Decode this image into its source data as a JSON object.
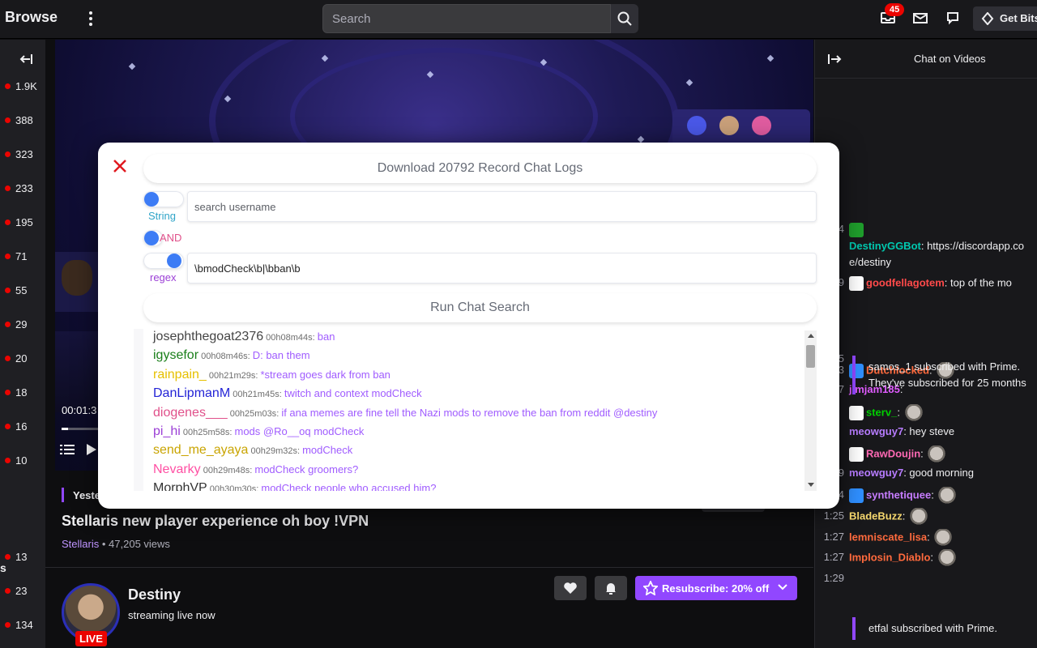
{
  "topbar": {
    "brand": "Browse",
    "search_placeholder": "Search",
    "notification_count": "45",
    "get_bits_label": "Get Bits"
  },
  "sidebar": {
    "viewer_counts": [
      "1.9K",
      "388",
      "323",
      "233",
      "195",
      "71",
      "55",
      "29",
      "20",
      "18",
      "16",
      "10"
    ],
    "section_letter": "s",
    "lower_counts": [
      "13",
      "23",
      "134"
    ]
  },
  "player": {
    "timecode": "00:01:3",
    "progress_fraction": 0.13
  },
  "vod": {
    "date_label": "Yeste",
    "title": "Stellaris new player experience oh boy !VPN",
    "category": "Stellaris",
    "separator": " • ",
    "views": "47,205 views"
  },
  "streamer": {
    "name": "Destiny",
    "status": "streaming live now",
    "live_label": "LIVE",
    "resub_label": "Resubscribe: 20% off"
  },
  "chat": {
    "title": "Chat on Videos",
    "messages": [
      {
        "ts": "4",
        "user": "",
        "color": "#00ad03",
        "text": ""
      },
      {
        "ts": "",
        "user": "DestinyGGBot",
        "color": "#00c8af",
        "text": "https://discordapp.co"
      },
      {
        "ts": "",
        "user": "",
        "color": "",
        "text": "e/destiny"
      },
      {
        "ts": "9",
        "user": "goodfellagotem",
        "color": "#ff4a4a",
        "text": "top of the mo"
      },
      {
        "ts": "3",
        "user": "Dutchlocked",
        "color": "#ff6a3d",
        "text": ""
      },
      {
        "ts": "7",
        "user": "jimjam185",
        "color": "#e05cff",
        "text": ""
      },
      {
        "ts": "",
        "user": "sterv_",
        "color": "#00d000",
        "text": ""
      },
      {
        "ts": "",
        "user": "meowguy7",
        "color": "#b77cff",
        "text": "hey steve"
      },
      {
        "ts": "",
        "user": "RawDoujin",
        "color": "#ff69b4",
        "text": ""
      },
      {
        "ts": "1:19",
        "user": "meowguy7",
        "color": "#b77cff",
        "text": "good morning"
      },
      {
        "ts": "1:24",
        "user": "synthetiquee",
        "color": "#c77dff",
        "text": ""
      },
      {
        "ts": "1:25",
        "user": "BladeBuzz",
        "color": "#f5d76e",
        "text": ""
      },
      {
        "ts": "1:27",
        "user": "lemniscate_lisa",
        "color": "#ff6a3d",
        "text": ""
      },
      {
        "ts": "1:27",
        "user": "Implosin_Diablo",
        "color": "#ff6a3d",
        "text": ""
      },
      {
        "ts": "1:29",
        "user": "",
        "color": "",
        "text": ""
      }
    ],
    "sub1_line1": "samos_1 subscribed with Prime.",
    "sub1_line2": "They've subscribed for 25 months",
    "sub1_ts": "5",
    "sub2_text": "etfal subscribed with Prime."
  },
  "modal": {
    "download_label": "Download 20792 Record Chat Logs",
    "toggle1_label": "String",
    "toggle2_label": "AND",
    "toggle3_label": "regex",
    "username_placeholder": "search username",
    "regex_value": "\\bmodCheck\\b|\\bban\\b",
    "run_label": "Run Chat Search",
    "results": [
      {
        "user": "josephthegoat2376",
        "color": "#444444",
        "time": " 00h08m44s",
        "msg": "ban"
      },
      {
        "user": "igysefor",
        "color": "#1a7f1a",
        "time": " 00h08m46s",
        "msg": "D: ban them"
      },
      {
        "user": "rainpain_",
        "color": "#e6c000",
        "time": " 00h21m29s",
        "msg": "*stream goes dark from ban"
      },
      {
        "user": "DanLipmanM",
        "color": "#2323d6",
        "time": " 00h21m45s",
        "msg": "twitch and context modCheck"
      },
      {
        "user": "diogenes___",
        "color": "#e0508a",
        "time": " 00h25m03s",
        "msg": "if ana memes are fine tell the Nazi mods to remove the ban from reddit @destiny"
      },
      {
        "user": "pi_hi",
        "color": "#9b3fd6",
        "time": " 00h25m58s",
        "msg": "mods @Ro__oq modCheck"
      },
      {
        "user": "send_me_ayaya",
        "color": "#c9a400",
        "time": " 00h29m32s",
        "msg": "modCheck"
      },
      {
        "user": "Nevarky",
        "color": "#ff4fa3",
        "time": " 00h29m48s",
        "msg": "modCheck groomers?"
      },
      {
        "user": "MorphVP",
        "color": "#333333",
        "time": " 00h30m30s",
        "msg": "modCheck people who accused him?"
      }
    ]
  },
  "colors": {
    "accent": "#9147ff",
    "live_red": "#eb0400",
    "toggle_blue": "#3d7cf5",
    "close_red": "#e0191f"
  }
}
